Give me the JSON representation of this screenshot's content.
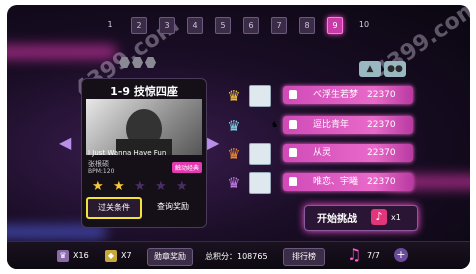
{
  "tabs": [
    "1",
    "2",
    "3",
    "4",
    "5",
    "6",
    "7",
    "8",
    "9",
    "10"
  ],
  "active_tab": "9",
  "card": {
    "title": "1-9 技惊四座",
    "song": "I Just Wanna Have Fun",
    "artist": "张根硕",
    "bpm": "BPM:120",
    "badge": "触动经典",
    "stars_filled": 2,
    "stars_total": 5,
    "condition_button": "过关条件",
    "reward_button": "查询奖励"
  },
  "ranking": [
    {
      "name": "べ浮生若梦",
      "score": "22370",
      "crown": "gold"
    },
    {
      "name": "逗比青年",
      "score": "22370",
      "crown": "silver"
    },
    {
      "name": "从灵",
      "score": "22370",
      "crown": "orange"
    },
    {
      "name": "唯恋、宇曦",
      "score": "22370",
      "crown": "purple"
    }
  ],
  "start": {
    "label": "开始挑战",
    "count": "x1"
  },
  "bottom": {
    "x16": "X16",
    "x7": "X7",
    "medal_button": "勋章奖励",
    "total_score": "总积分：108765",
    "leaderboard_button": "排行榜",
    "page": "7/7"
  },
  "watermark": "4399.com",
  "colors": {
    "accent": "#e23ab0",
    "highlight": "#f4e23a",
    "bar": "#d04ab8"
  }
}
